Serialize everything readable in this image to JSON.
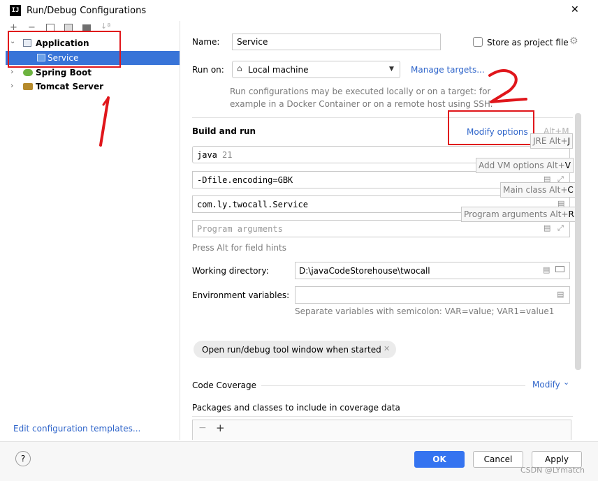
{
  "window": {
    "title": "Run/Debug Configurations",
    "close_glyph": "✕"
  },
  "tree": {
    "toolbar_icons": [
      "add-icon",
      "remove-icon",
      "copy-icon",
      "save-icon",
      "folder-icon",
      "sort-icon"
    ],
    "items": [
      {
        "label": "Application",
        "bold": true,
        "icon": "application-icon"
      },
      {
        "label": "Service",
        "selected": true,
        "icon": "class-icon"
      },
      {
        "label": "Spring Boot",
        "bold": true,
        "icon": "spring-boot-icon"
      },
      {
        "label": "Tomcat Server",
        "bold": true,
        "icon": "tomcat-icon"
      }
    ],
    "edit_templates_link": "Edit configuration templates..."
  },
  "form": {
    "name_label": "Name:",
    "name_value": "Service",
    "store_label": "Store as project file",
    "run_on_label": "Run on:",
    "run_on_value": "Local machine",
    "manage_targets": "Manage targets...",
    "run_on_hint_1": "Run configurations may be executed locally or on a target: for",
    "run_on_hint_2": "example in a Docker Container or on a remote host using SSH.",
    "build_run_title": "Build and run",
    "modify_options": "Modify options",
    "modify_shortcut": "Alt+M",
    "jre_value": "java",
    "jre_version": "21",
    "vm_options": "-Dfile.encoding=GBK",
    "main_class": "com.ly.twocall.Service",
    "program_args_placeholder": "Program arguments",
    "field_hint": "Press Alt for field hints",
    "working_dir_label": "Working directory:",
    "working_dir_value": "D:\\javaCodeStorehouse\\twocall",
    "env_label": "Environment variables:",
    "env_hint": "Separate variables with semicolon: VAR=value; VAR1=value1",
    "open_tool_window": "Open run/debug tool window when started",
    "code_coverage": "Code Coverage",
    "modify": "Modify",
    "packages_label": "Packages and classes to include in coverage data"
  },
  "tooltips": {
    "jre": {
      "text": "JRE Alt+",
      "key": "J"
    },
    "vm": {
      "text": "Add VM options Alt+",
      "key": "V"
    },
    "main": {
      "text": "Main class Alt+",
      "key": "C"
    },
    "args": {
      "text": "Program arguments Alt+",
      "key": "R"
    }
  },
  "buttons": {
    "help": "?",
    "ok": "OK",
    "cancel": "Cancel",
    "apply": "Apply"
  },
  "watermark": "CSDN @LYmatch",
  "annotations": {
    "one": "1",
    "two": "2"
  },
  "colors": {
    "accent": "#3574f0",
    "selection": "#3874d8",
    "red_box": "#e0161b",
    "link": "#2f65ca"
  }
}
